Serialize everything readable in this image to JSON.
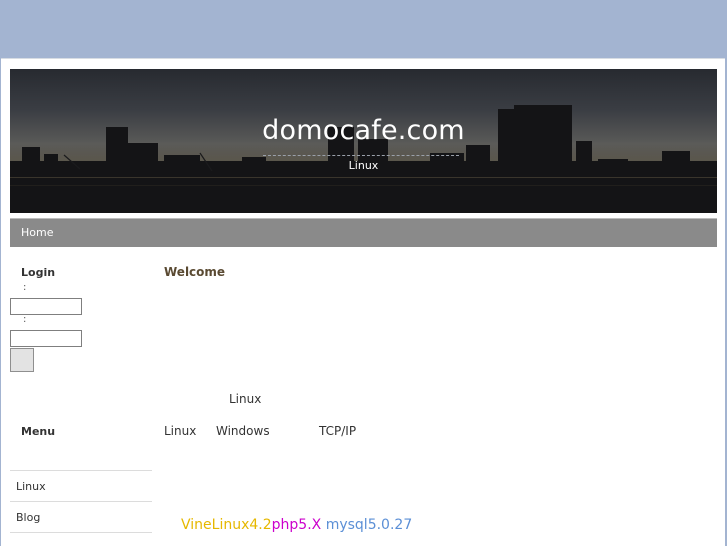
{
  "header": {
    "site_title": "domocafe.com",
    "subtitle": "Linux"
  },
  "nav": {
    "items": [
      {
        "label": "Home"
      }
    ]
  },
  "sidebar": {
    "login_heading": "Login",
    "colon_1": ":",
    "colon_2": ":",
    "username_value": "",
    "password_value": "",
    "submit_label": "",
    "menu_heading": "Menu",
    "menu_items": [
      {
        "label": "Linux"
      },
      {
        "label": "Blog"
      }
    ]
  },
  "main": {
    "welcome": "Welcome",
    "line_linux": "Linux",
    "row_linux": "Linux",
    "row_windows": "Windows",
    "row_tcpip": "TCP/IP",
    "tech": {
      "vinelinux": "VineLinux4.2",
      "php": "php5.X",
      "mysql": "mysql5.0.27"
    }
  },
  "colors": {
    "outer_background": "#a3b4d1",
    "nav_bar": "#8a8a8a",
    "vinelinux": "#e6b800",
    "php": "#cc00cc",
    "mysql": "#5b8fd6"
  }
}
